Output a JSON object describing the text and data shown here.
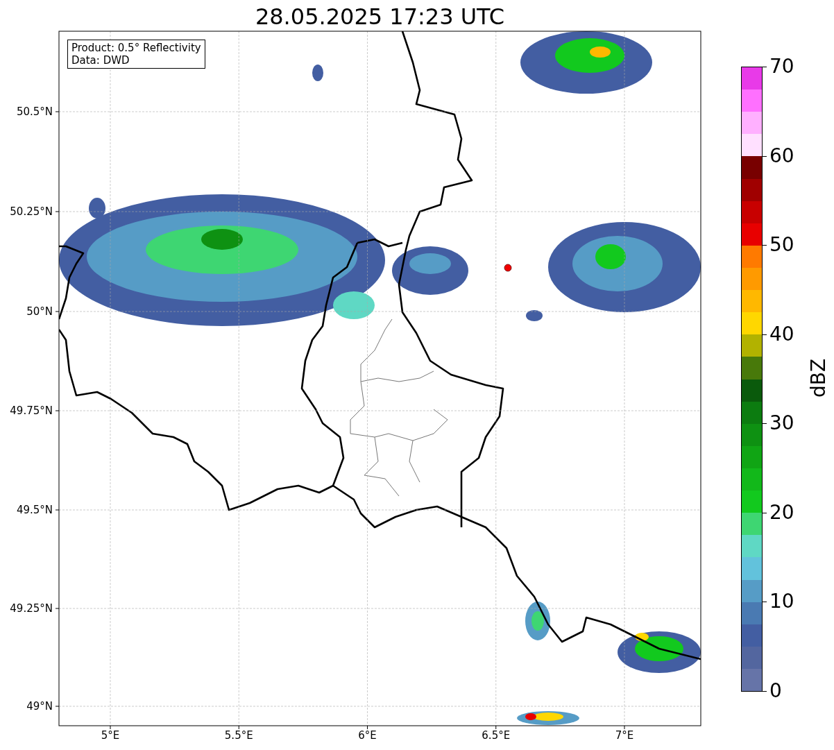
{
  "title": "28.05.2025 17:23 UTC",
  "info_box": {
    "lines": [
      "Product: 0.5° Reflectivity",
      "Data: DWD"
    ]
  },
  "map": {
    "y_ticks": [
      "50.5°N",
      "50.25°N",
      "50°N",
      "49.75°N",
      "49.5°N",
      "49.25°N",
      "49°N"
    ],
    "x_ticks": [
      "5°E",
      "5.5°E",
      "6°E",
      "6.5°E",
      "7°E"
    ]
  },
  "colorbar": {
    "label": "dBZ",
    "ticks": [
      "70",
      "60",
      "50",
      "40",
      "30",
      "20",
      "10",
      "0"
    ],
    "bands": [
      {
        "color": "#e83ae8"
      },
      {
        "color": "#ff70ff"
      },
      {
        "color": "#ffb0ff"
      },
      {
        "color": "#ffe0ff"
      },
      {
        "color": "#780000"
      },
      {
        "color": "#a00000"
      },
      {
        "color": "#c80000"
      },
      {
        "color": "#e80000"
      },
      {
        "color": "#ff7a00"
      },
      {
        "color": "#ff9a00"
      },
      {
        "color": "#ffb800"
      },
      {
        "color": "#ffd700"
      },
      {
        "color": "#b2b200"
      },
      {
        "color": "#48790a"
      },
      {
        "color": "#0a5a0c"
      },
      {
        "color": "#0c7c10"
      },
      {
        "color": "#0e9112"
      },
      {
        "color": "#10a514"
      },
      {
        "color": "#12b81a"
      },
      {
        "color": "#12c91e"
      },
      {
        "color": "#3ed672"
      },
      {
        "color": "#5fd8c4"
      },
      {
        "color": "#62c2dc"
      },
      {
        "color": "#569cc6"
      },
      {
        "color": "#4a7ab2"
      },
      {
        "color": "#435ea2"
      },
      {
        "color": "#53669f"
      },
      {
        "color": "#6674a8"
      }
    ]
  }
}
